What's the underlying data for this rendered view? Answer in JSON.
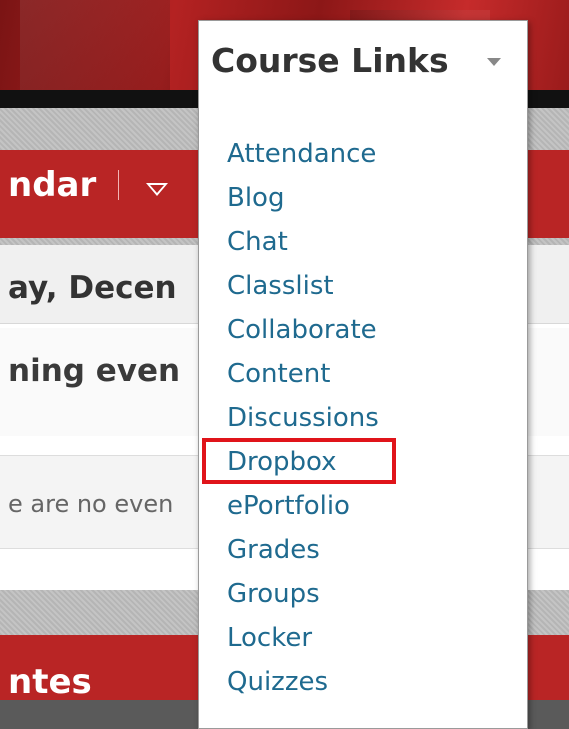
{
  "background": {
    "nav_label": "ndar",
    "date_text": "ay, Decen",
    "upcoming_text": "ning even",
    "no_events_text": "e are no even",
    "notes_label": "ntes"
  },
  "dropdown": {
    "title": "Course Links",
    "items": [
      "Attendance",
      "Blog",
      "Chat",
      "Classlist",
      "Collaborate",
      "Content",
      "Discussions",
      "Dropbox",
      "ePortfolio",
      "Grades",
      "Groups",
      "Locker",
      "Quizzes"
    ],
    "highlighted_item": "Dropbox"
  },
  "colors": {
    "brand_red": "#b92525",
    "link_blue": "#1f6a8f",
    "highlight_red": "#e0141a"
  }
}
